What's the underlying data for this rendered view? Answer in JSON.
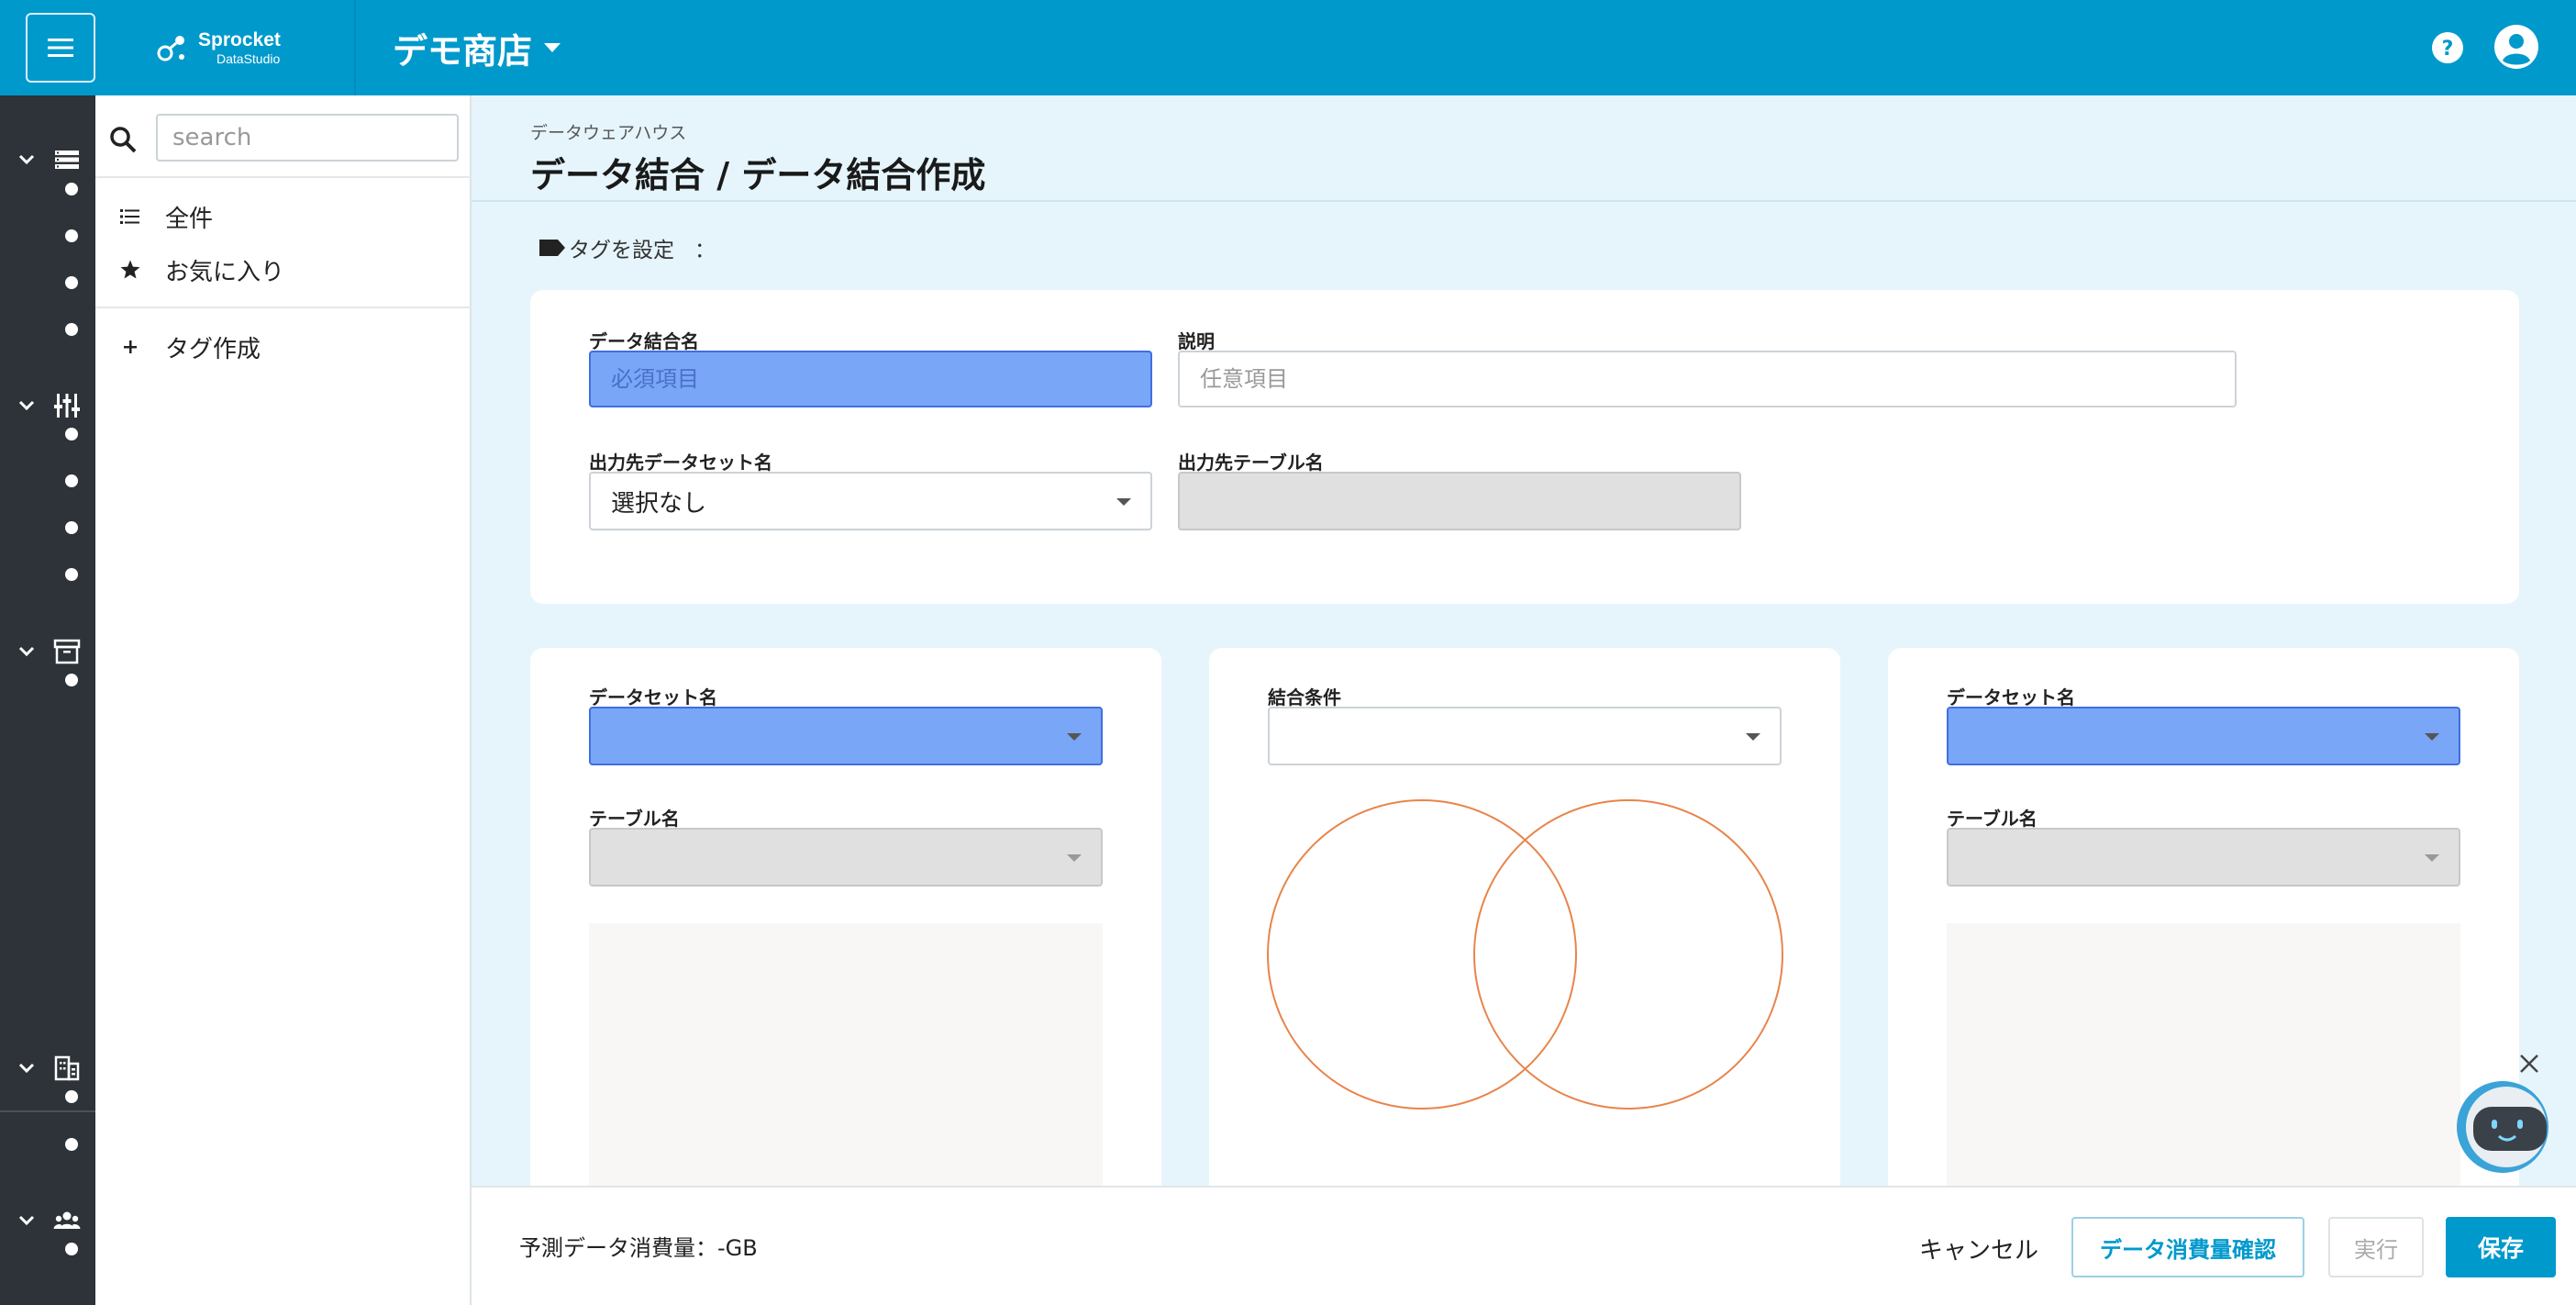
{
  "header": {
    "logo_line1": "Sprocket",
    "logo_line2": "DataStudio",
    "store_name": "デモ商店",
    "colors": {
      "primary": "#0099cc",
      "rail": "#2d3338",
      "highlight_input": "#7aa6f7",
      "venn_stroke": "#e8844a"
    }
  },
  "sidebar": {
    "search_placeholder": "search",
    "items": [
      {
        "label": "全件",
        "icon": "list-icon"
      },
      {
        "label": "お気に入り",
        "icon": "star-icon"
      }
    ],
    "create_tag": {
      "label": "タグ作成",
      "icon": "plus-icon"
    }
  },
  "rail": {
    "groups": [
      {
        "icon": "storage-icon",
        "dots": 4
      },
      {
        "icon": "tune-icon",
        "dots": 4
      },
      {
        "icon": "archive-icon",
        "dots": 1
      },
      {
        "icon": "building-icon",
        "dots": 2
      },
      {
        "icon": "people-icon",
        "dots": 1
      }
    ]
  },
  "page": {
    "breadcrumb": "データウェアハウス",
    "title": "データ結合 / データ結合作成",
    "tag_label": "タグを設定",
    "tag_separator": "："
  },
  "form": {
    "join_name_label": "データ結合名",
    "join_name_placeholder": "必須項目",
    "description_label": "説明",
    "description_placeholder": "任意項目",
    "output_dataset_label": "出力先データセット名",
    "output_dataset_value": "選択なし",
    "output_table_label": "出力先テーブル名"
  },
  "join": {
    "left": {
      "dataset_label": "データセット名",
      "table_label": "テーブル名"
    },
    "center": {
      "condition_label": "結合条件"
    },
    "right": {
      "dataset_label": "データセット名",
      "table_label": "テーブル名"
    }
  },
  "footer": {
    "estimate": "予測データ消費量：-GB",
    "cancel": "キャンセル",
    "confirm": "データ消費量確認",
    "run": "実行",
    "save": "保存"
  }
}
